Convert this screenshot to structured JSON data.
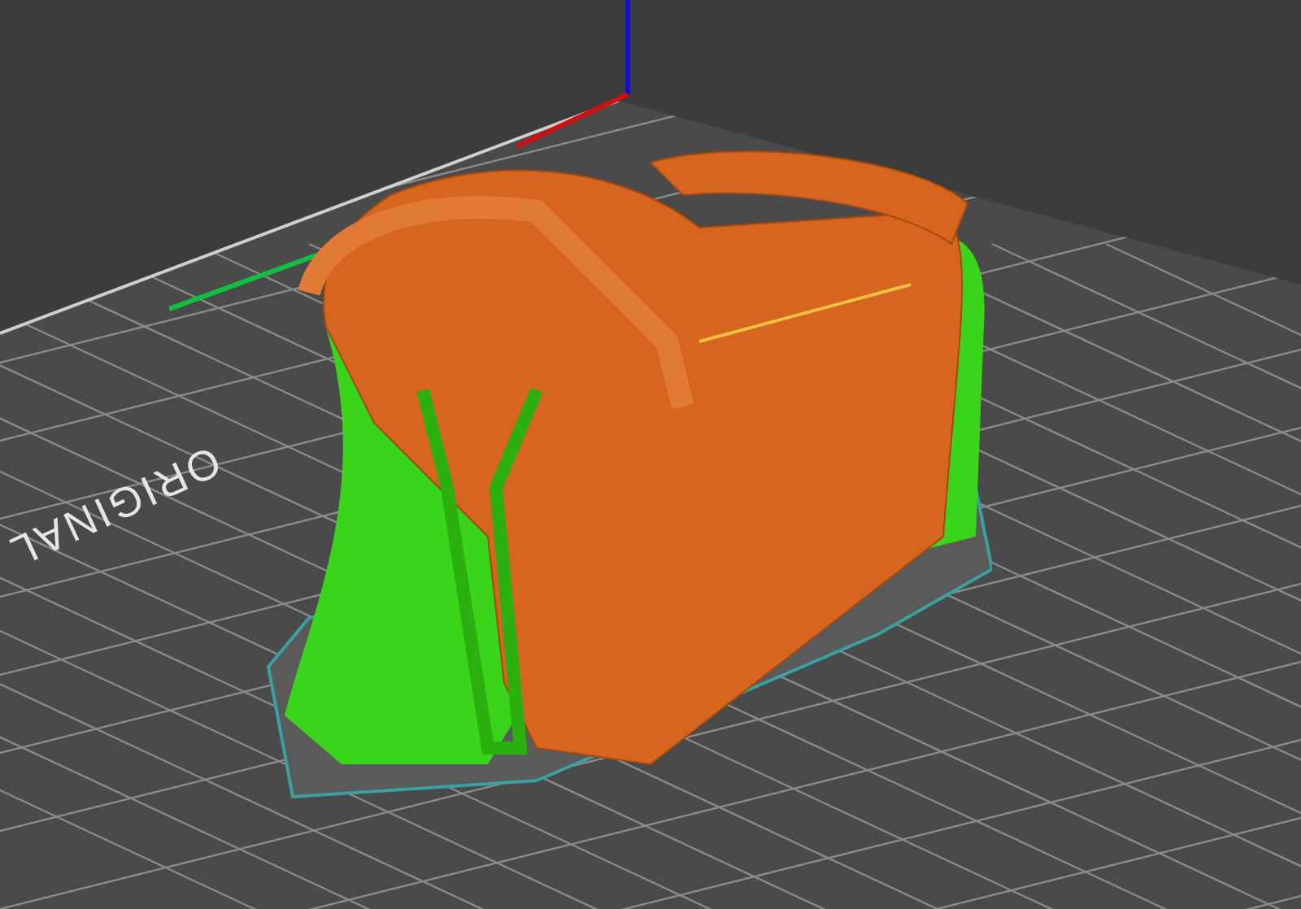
{
  "viewport": {
    "bed_label": "ORIGINAL"
  }
}
